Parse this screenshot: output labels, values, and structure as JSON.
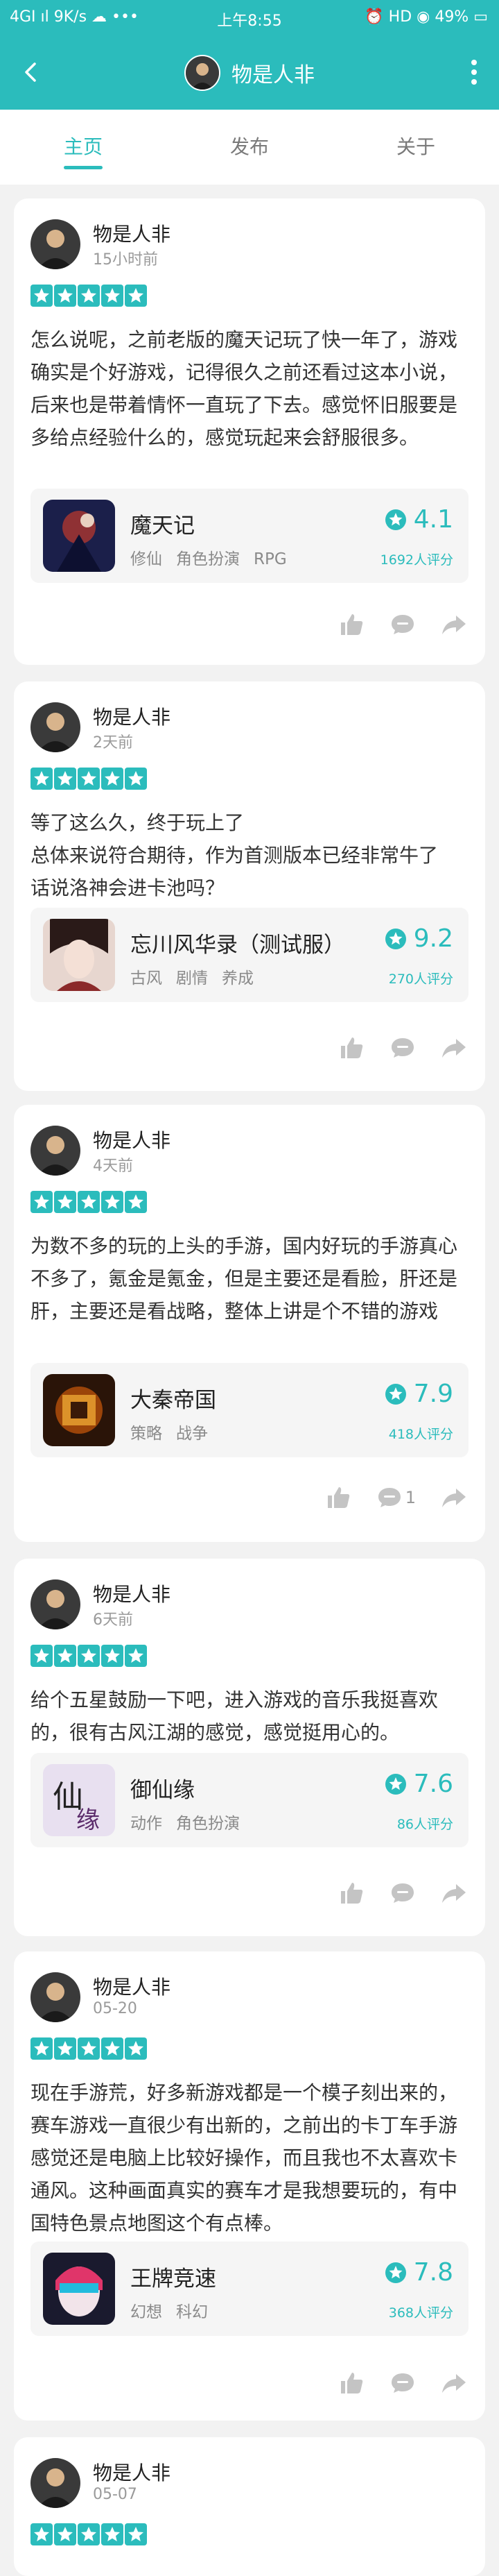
{
  "status": {
    "left": "4GІ ıl 9K/s ☁ •••",
    "time": "上午8:55",
    "right": "⏰ HD ◉ 49% ▭"
  },
  "header": {
    "title": "物是人非"
  },
  "tabs": [
    {
      "label": "主页"
    },
    {
      "label": "发布"
    },
    {
      "label": "关于"
    }
  ],
  "reviews": [
    {
      "user": "物是人非",
      "time": "15小时前",
      "rating": 5,
      "text": "怎么说呢，之前老版的魔天记玩了快一年了，游戏确实是个好游戏，记得很久之前还看过这本小说，后来也是带着情怀一直玩了下去。感觉怀旧服要是多给点经验什么的，感觉玩起来会舒服很多。",
      "game": {
        "name": "魔天记",
        "tags": [
          "修仙",
          "角色扮演",
          "RPG"
        ],
        "score": "4.1",
        "count": "1692人评分"
      },
      "comment_count": ""
    },
    {
      "user": "物是人非",
      "time": "2天前",
      "rating": 5,
      "text": "等了这么久，终于玩上了\n总体来说符合期待，作为首测版本已经非常牛了\n话说洛神会进卡池吗？",
      "game": {
        "name": "忘川风华录（测试服）",
        "tags": [
          "古风",
          "剧情",
          "养成"
        ],
        "score": "9.2",
        "count": "270人评分"
      },
      "comment_count": ""
    },
    {
      "user": "物是人非",
      "time": "4天前",
      "rating": 5,
      "text": "为数不多的玩的上头的手游，国内好玩的手游真心不多了，氪金是氪金，但是主要还是看脸，肝还是肝，主要还是看战略，整体上讲是个不错的游戏",
      "game": {
        "name": "大秦帝国",
        "tags": [
          "策略",
          "战争"
        ],
        "score": "7.9",
        "count": "418人评分"
      },
      "comment_count": "1"
    },
    {
      "user": "物是人非",
      "time": "6天前",
      "rating": 5,
      "text": "给个五星鼓励一下吧，进入游戏的音乐我挺喜欢的，很有古风江湖的感觉，感觉挺用心的。",
      "game": {
        "name": "御仙缘",
        "tags": [
          "动作",
          "角色扮演"
        ],
        "score": "7.6",
        "count": "86人评分"
      },
      "comment_count": ""
    },
    {
      "user": "物是人非",
      "time": "05-20",
      "rating": 5,
      "text": "现在手游荒，好多新游戏都是一个模子刻出来的，赛车游戏一直很少有出新的，之前出的卡丁车手游感觉还是电脑上比较好操作，而且我也不太喜欢卡通风。这种画面真实的赛车才是我想要玩的，有中国特色景点地图这个有点棒。",
      "game": {
        "name": "王牌竞速",
        "tags": [
          "幻想",
          "科幻"
        ],
        "score": "7.8",
        "count": "368人评分"
      },
      "comment_count": ""
    },
    {
      "user": "物是人非",
      "time": "05-07",
      "rating": 5
    }
  ],
  "colors": {
    "accent": "#2bbcbc",
    "background": "#f2f2f2",
    "icon_gray": "#c4c4c4"
  }
}
